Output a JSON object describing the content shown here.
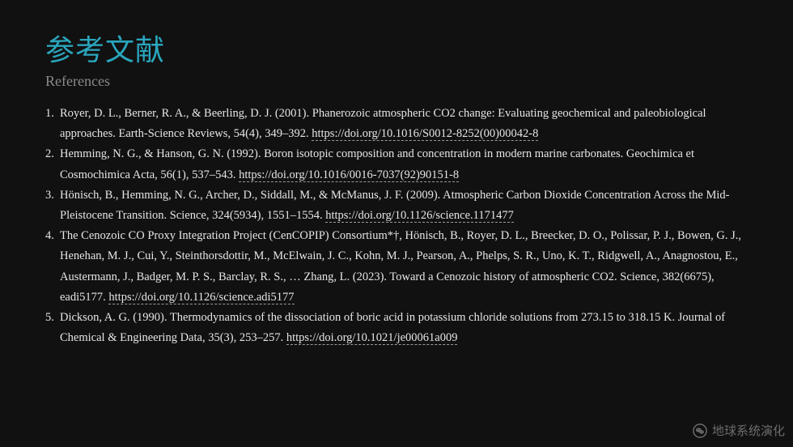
{
  "header": {
    "title": "参考文献",
    "subtitle": "References"
  },
  "references": [
    {
      "number": "1.",
      "text": "Royer, D. L., Berner, R. A., & Beerling, D. J. (2001). Phanerozoic atmospheric CO2 change: Evaluating geochemical and paleobiological approaches. Earth-Science Reviews, 54(4), 349–392. ",
      "link": "https://doi.org/10.1016/S0012-8252(00)00042-8"
    },
    {
      "number": "2.",
      "text": "Hemming, N. G., & Hanson, G. N. (1992). Boron isotopic composition and concentration in modern marine carbonates. Geochimica et Cosmochimica Acta, 56(1), 537–543. ",
      "link": "https://doi.org/10.1016/0016-7037(92)90151-8"
    },
    {
      "number": "3.",
      "text": "Hönisch, B., Hemming, N. G., Archer, D., Siddall, M., & McManus, J. F. (2009). Atmospheric Carbon Dioxide Concentration Across the Mid-Pleistocene Transition. Science, 324(5934), 1551–1554. ",
      "link": "https://doi.org/10.1126/science.1171477"
    },
    {
      "number": "4.",
      "text": "The Cenozoic CO Proxy Integration Project (CenCOPIP) Consortium*†, Hönisch, B., Royer, D. L., Breecker, D. O., Polissar, P. J., Bowen, G. J., Henehan, M. J., Cui, Y., Steinthorsdottir, M., McElwain, J. C., Kohn, M. J., Pearson, A., Phelps, S. R., Uno, K. T., Ridgwell, A., Anagnostou, E., Austermann, J., Badger, M. P. S., Barclay, R. S., … Zhang, L. (2023). Toward a Cenozoic history of atmospheric CO2. Science, 382(6675), eadi5177. ",
      "link": "https://doi.org/10.1126/science.adi5177"
    },
    {
      "number": "5.",
      "text": "Dickson, A. G. (1990). Thermodynamics of the dissociation of boric acid in potassium chloride solutions from 273.15 to 318.15 K. Journal of Chemical & Engineering Data, 35(3), 253–257. ",
      "link": "https://doi.org/10.1021/je00061a009"
    }
  ],
  "watermark": {
    "text": "地球系统演化",
    "icon": "wechat-icon"
  },
  "colors": {
    "background": "#111111",
    "title": "#2aa6be",
    "subtitle": "#8a8a8a",
    "body_text": "#e6e6e6"
  }
}
